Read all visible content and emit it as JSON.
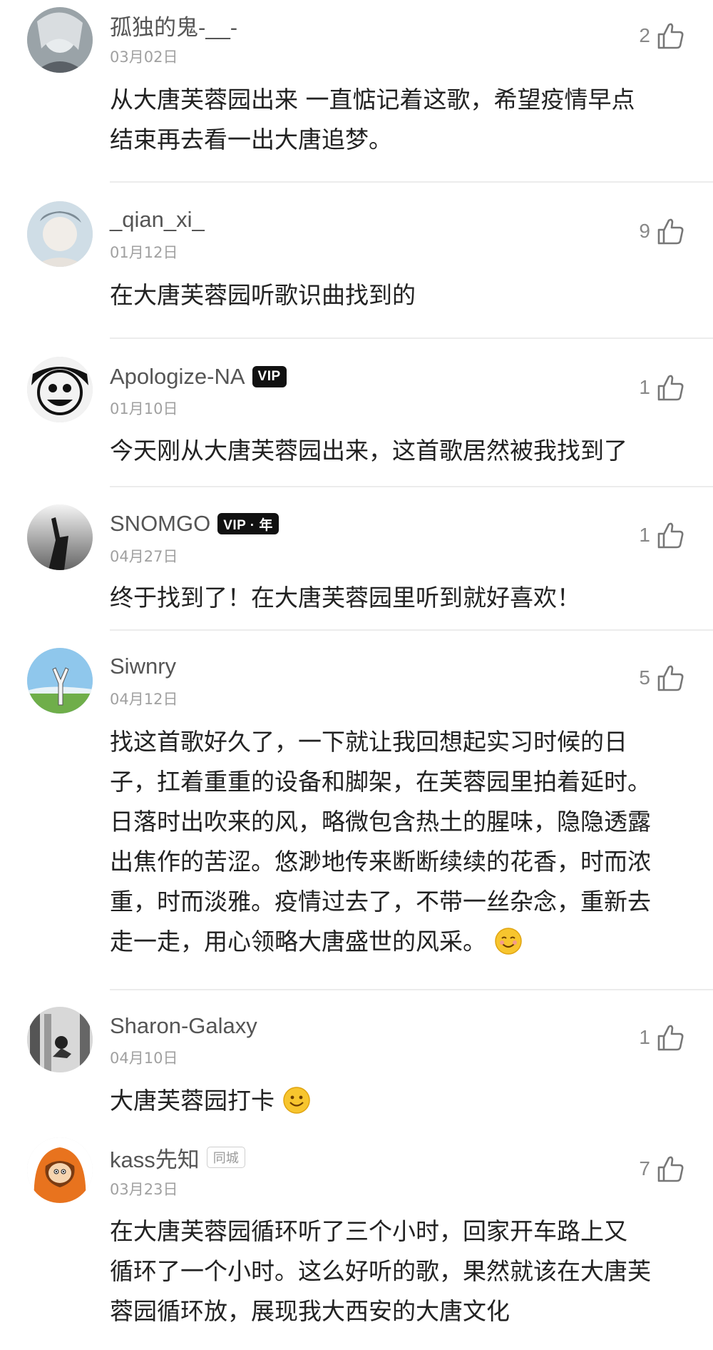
{
  "comments": [
    {
      "username": "孤独的鬼-__-",
      "date": "03月02日",
      "likes": "2",
      "lines": [
        "从大唐芙蓉园出来 一直惦记着这歌，希望疫情早点",
        "结束再去看一出大唐追梦。"
      ]
    },
    {
      "username": "_qian_xi_",
      "date": "01月12日",
      "likes": "9",
      "lines": [
        "在大唐芙蓉园听歌识曲找到的"
      ]
    },
    {
      "username": "Apologize-NA",
      "badge": "VIP",
      "date": "01月10日",
      "likes": "1",
      "lines": [
        "今天刚从大唐芙蓉园出来，这首歌居然被我找到了"
      ]
    },
    {
      "username": "SNOMGO",
      "badge": "VIP · 年",
      "date": "04月27日",
      "likes": "1",
      "lines": [
        "终于找到了！在大唐芙蓉园里听到就好喜欢！"
      ]
    },
    {
      "username": "Siwnry",
      "date": "04月12日",
      "likes": "5",
      "lines": [
        "找这首歌好久了，一下就让我回想起实习时候的日",
        "子，扛着重重的设备和脚架，在芙蓉园里拍着延时。",
        "日落时出吹来的风，略微包含热土的腥味，隐隐透露",
        "出焦作的苦涩。悠渺地传来断断续续的花香，时而浓",
        "重，时而淡雅。疫情过去了，不带一丝杂念，重新去",
        "走一走，用心领略大唐盛世的风采。"
      ],
      "emoji": "smiling-face-emoji"
    },
    {
      "username": "Sharon-Galaxy",
      "date": "04月10日",
      "likes": "1",
      "lines": [
        "大唐芙蓉园打卡"
      ],
      "emoji": "smile-emoji"
    },
    {
      "username": "kass先知",
      "tag": "同城",
      "date": "03月23日",
      "likes": "7",
      "lines": [
        "在大唐芙蓉园循环听了三个小时，回家开车路上又",
        "循环了一个小时。这么好听的歌，果然就该在大唐芙",
        "蓉园循环放，展现我大西安的大唐文化"
      ]
    }
  ],
  "icons": {
    "like": "thumbs-up-icon"
  },
  "colors": {
    "divider": "#ececec",
    "badge": "#111111",
    "avatar_orange": "#e8731e"
  }
}
